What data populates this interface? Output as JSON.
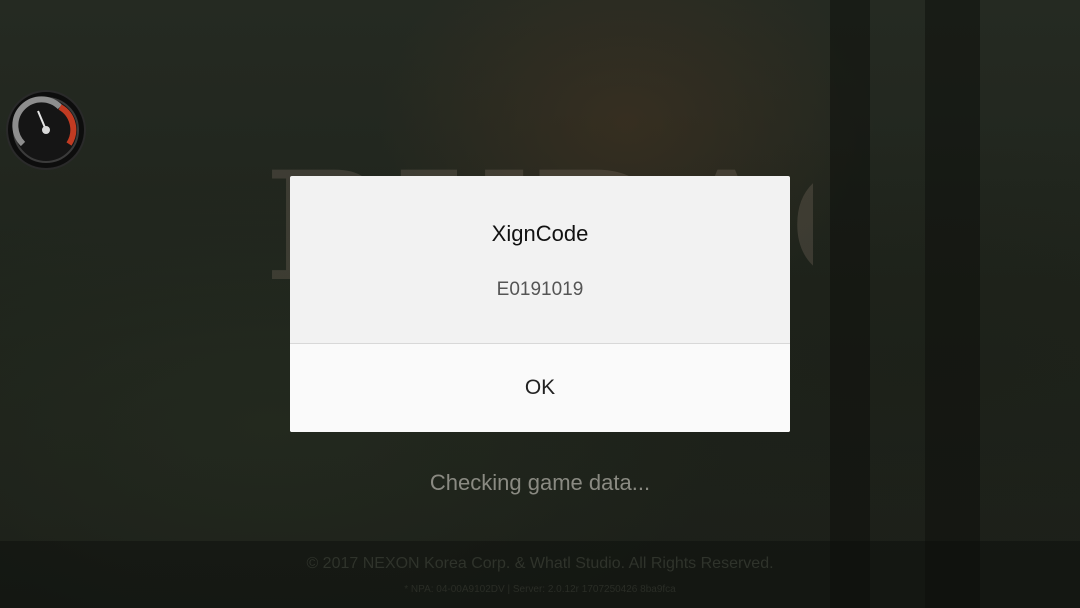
{
  "game_logo_text": "RUDAGO",
  "status_text": "Checking game data...",
  "footer": {
    "copyright": "© 2017 NEXON Korea Corp. & Whatl Studio. All Rights Reserved.",
    "version": "* NPA: 04-00A9102DV | Server: 2.0.12r 1707250426 8ba9fca"
  },
  "dialog": {
    "title": "XignCode",
    "message": "E0191019",
    "ok_label": "OK"
  },
  "icons": {
    "gauge": "speedometer-gauge-icon"
  },
  "colors": {
    "dialog_bg": "#f2f2f2",
    "gauge_red": "#c23b22"
  }
}
